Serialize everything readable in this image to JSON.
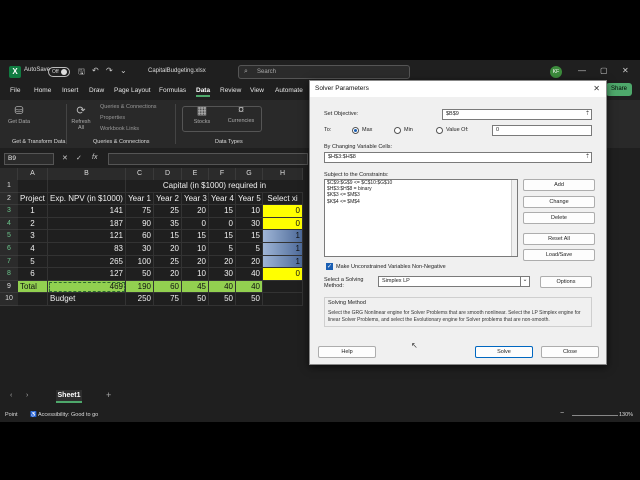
{
  "titlebar": {
    "logo": "X",
    "autosave": "AutoSave",
    "toggle": "Off",
    "filename": "CapitalBudgeting.xlsx",
    "search_placeholder": "Search",
    "avatar": "KF"
  },
  "tabs": [
    "File",
    "Home",
    "Insert",
    "Draw",
    "Page Layout",
    "Formulas",
    "Data",
    "Review",
    "View",
    "Automate"
  ],
  "active_tab": "Data",
  "share": "Share",
  "ribbon": {
    "get_data": "Get Data",
    "refresh_all": "Refresh All",
    "queries_connections": "Queries & Connections",
    "properties": "Properties",
    "workbook_links": "Workbook Links",
    "stocks": "Stocks",
    "currencies": "Currencies",
    "group_get_transform": "Get & Transform Data",
    "group_queries": "Queries & Connections",
    "group_datatypes": "Data Types"
  },
  "formula_bar": {
    "name_box": "B9",
    "fx": "fx"
  },
  "grid": {
    "columns": [
      "A",
      "B",
      "C",
      "D",
      "E",
      "F",
      "G",
      "H"
    ],
    "rows": [
      [
        "",
        "",
        "Capital (in $1000) required in",
        "",
        "",
        "",
        "",
        ""
      ],
      [
        "Project",
        "Exp. NPV (in $1000)",
        "Year 1",
        "Year 2",
        "Year 3",
        "Year 4",
        "Year 5",
        "Select xi"
      ],
      [
        "1",
        "141",
        "75",
        "25",
        "20",
        "15",
        "10",
        "0"
      ],
      [
        "2",
        "187",
        "90",
        "35",
        "0",
        "0",
        "30",
        "0"
      ],
      [
        "3",
        "121",
        "60",
        "15",
        "15",
        "15",
        "15",
        "1"
      ],
      [
        "4",
        "83",
        "30",
        "20",
        "10",
        "5",
        "5",
        "1"
      ],
      [
        "5",
        "265",
        "100",
        "25",
        "20",
        "20",
        "20",
        "1"
      ],
      [
        "6",
        "127",
        "50",
        "20",
        "10",
        "30",
        "40",
        "0"
      ],
      [
        "Total",
        "469",
        "190",
        "60",
        "45",
        "40",
        "40",
        ""
      ],
      [
        "",
        "Budget",
        "250",
        "75",
        "50",
        "50",
        "50",
        ""
      ]
    ]
  },
  "sheet_tab": "Sheet1",
  "status": {
    "mode": "Point",
    "accessibility": "Accessibility: Good to go",
    "zoom": "130%"
  },
  "solver": {
    "title": "Solver Parameters",
    "set_objective_label": "Set Objective:",
    "objective": "$B$9",
    "to_label": "To:",
    "max": "Max",
    "min": "Min",
    "value_of": "Value Of:",
    "value_of_input": "0",
    "changing_label": "By Changing Variable Cells:",
    "changing": "$H$3:$H$8",
    "constraints_label": "Subject to the Constraints:",
    "constraints": [
      "$C$9:$G$9 <= $C$10:$G$10",
      "$H$3:$H$8 = binary",
      "$K$3 <= $M$3",
      "$K$4 <= $M$4"
    ],
    "btn_add": "Add",
    "btn_change": "Change",
    "btn_delete": "Delete",
    "btn_reset": "Reset All",
    "btn_loadsave": "Load/Save",
    "nonneg": "Make Unconstrained Variables Non-Negative",
    "method_label_1": "Select a Solving",
    "method_label_2": "Method:",
    "method": "Simplex LP",
    "btn_options": "Options",
    "solving_method_title": "Solving Method",
    "solving_method_text": "Select the GRG Nonlinear engine for Solver Problems that are smooth nonlinear. Select the LP Simplex engine for linear Solver Problems, and select the Evolutionary engine for Solver problems that are non-smooth.",
    "btn_help": "Help",
    "btn_solve": "Solve",
    "btn_close": "Close"
  }
}
